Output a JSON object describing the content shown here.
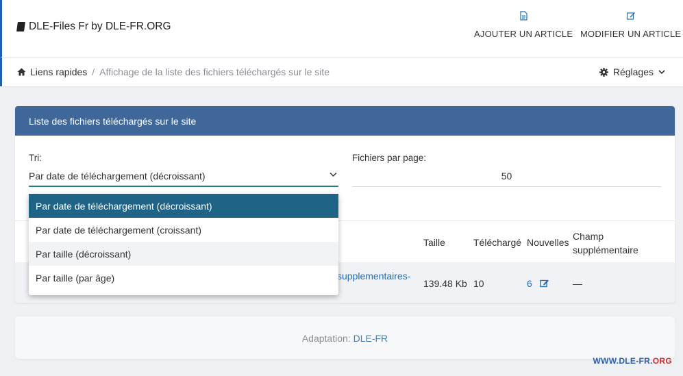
{
  "header": {
    "brand": "DLE-Files Fr by DLE-FR.ORG",
    "actions": [
      {
        "label": "AJOUTER UN ARTICLE",
        "icon": "file-icon"
      },
      {
        "label": "MODIFIER UN ARTICLE",
        "icon": "edit-icon"
      }
    ]
  },
  "breadcrumb": {
    "home": "Liens rapides",
    "separator": "/",
    "current": "Affichage de la liste des fichiers téléchargés sur le site"
  },
  "settings": {
    "label": "Réglages"
  },
  "panel": {
    "title": "Liste des fichiers téléchargés sur le site",
    "sort_label": "Tri:",
    "sort_value": "Par date de téléchargement (décroissant)",
    "per_page_label": "Fichiers par page:",
    "per_page_value": "50"
  },
  "dropdown": {
    "options": [
      "Par date de téléchargement (décroissant)",
      "Par date de téléchargement (croissant)",
      "Par taille (décroissant)",
      "Par taille (par âge)"
    ],
    "selected_index": 0
  },
  "table": {
    "headers": {
      "size": "Taille",
      "downloads": "Téléchargé",
      "news": "Nouvelles",
      "extra_1": "Champ",
      "extra_2": "supplémentaire"
    },
    "rows": [
      {
        "name_fragment": "supplementaires-",
        "size": "139.48 Kb",
        "downloads": "10",
        "news": "6",
        "extra": "—"
      }
    ]
  },
  "footer": {
    "text": "Adaptation:",
    "link": "DLE-FR"
  },
  "watermark": {
    "part1": "WWW.DLE-FR.",
    "part2": "ORG"
  },
  "colors": {
    "accent": "#40679a",
    "active_option": "#1f6386",
    "link": "#1e6fb8",
    "brand_bar": "#1e5fae"
  }
}
